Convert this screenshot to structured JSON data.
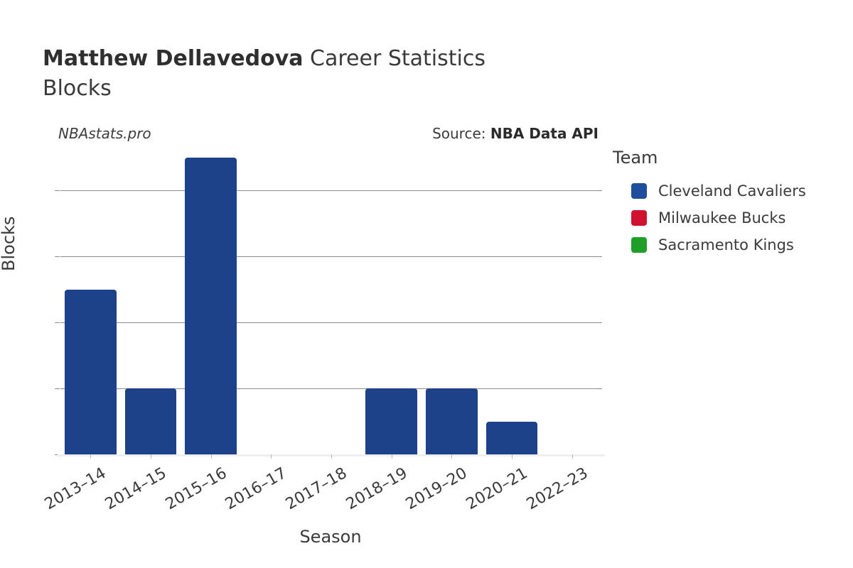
{
  "header": {
    "player_name": "Matthew Dellavedova",
    "title_suffix": " Career Statistics",
    "stat_name": "Blocks"
  },
  "caption": {
    "watermark": "NBAstats.pro",
    "source_prefix": "Source: ",
    "source_name": "NBA Data API"
  },
  "legend": {
    "title": "Team",
    "items": [
      {
        "label": "Cleveland Cavaliers",
        "color": "#1f4e9c"
      },
      {
        "label": "Milwaukee Bucks",
        "color": "#d0112f"
      },
      {
        "label": "Sacramento Kings",
        "color": "#1f9e29"
      }
    ]
  },
  "chart_data": {
    "type": "bar",
    "title": "Matthew Dellavedova Career Statistics Blocks",
    "xlabel": "Season",
    "ylabel": "Blocks",
    "categories": [
      "2013–14",
      "2014–15",
      "2015–16",
      "2016–17",
      "2017–18",
      "2018–19",
      "2019–20",
      "2020–21",
      "2022–23"
    ],
    "values": [
      5,
      2,
      9,
      0,
      0,
      2,
      2,
      1,
      0
    ],
    "bar_teams": [
      "Cleveland Cavaliers",
      "Cleveland Cavaliers",
      "Cleveland Cavaliers",
      "Cleveland Cavaliers",
      "Cleveland Cavaliers",
      "Cleveland Cavaliers",
      "Cleveland Cavaliers",
      "Cleveland Cavaliers",
      "Cleveland Cavaliers"
    ],
    "bar_color": "#1d4289",
    "ylim": [
      0,
      9
    ],
    "yticks": [
      0,
      2,
      4,
      6,
      8
    ],
    "ytick_labels": [
      "0",
      "2",
      "4",
      "6",
      "8"
    ],
    "grid": "horizontal",
    "legend_position": "right",
    "series": [
      {
        "name": "Cleveland Cavaliers",
        "values": [
          5,
          2,
          9,
          0,
          0,
          2,
          2,
          1,
          0
        ]
      },
      {
        "name": "Milwaukee Bucks",
        "values": [
          0,
          0,
          0,
          0,
          0,
          0,
          0,
          0,
          0
        ]
      },
      {
        "name": "Sacramento Kings",
        "values": [
          0,
          0,
          0,
          0,
          0,
          0,
          0,
          0,
          0
        ]
      }
    ]
  }
}
